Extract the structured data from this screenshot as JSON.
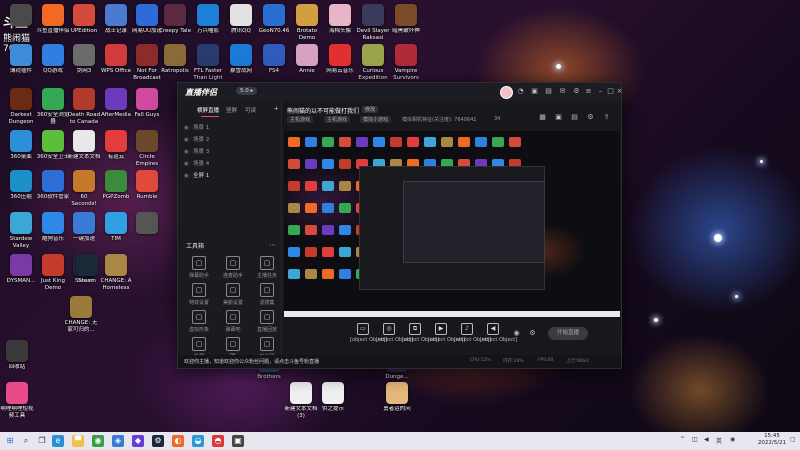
{
  "overlay": {
    "logo": "斗鱼",
    "name": "熊闹猫",
    "room": "7640"
  },
  "desktop": {
    "col1": [
      {
        "label": "",
        "color": "#4a4a4a",
        "icon": "computer-icon"
      },
      {
        "label": "薄荷插件",
        "color": "#3d8bd9",
        "icon": "app-icon"
      },
      {
        "label": "Darkest Dungeon",
        "color": "#6b2a14",
        "icon": "game-icon"
      },
      {
        "label": "360桌面",
        "color": "#2a8ed8",
        "icon": "app-icon"
      },
      {
        "label": "360压缩",
        "color": "#1e90c9",
        "icon": "app-icon"
      },
      {
        "label": "Stardew Valley",
        "color": "#3ca7d6",
        "icon": "game-icon"
      },
      {
        "label": "DYSMAN...",
        "color": "#7a3aa6",
        "icon": "game-icon"
      }
    ],
    "col2": [
      {
        "label": "斗鱼直播伴侣",
        "color": "#f16a25",
        "icon": "app-icon"
      },
      {
        "label": "QQ游戏",
        "color": "#2f7ee0",
        "icon": "app-icon"
      },
      {
        "label": "360安全浏览器",
        "color": "#34a853",
        "icon": "app-icon"
      },
      {
        "label": "360安全卫士",
        "color": "#5bbf3c",
        "icon": "app-icon"
      },
      {
        "label": "360软件管家",
        "color": "#2b6fd6",
        "icon": "app-icon"
      },
      {
        "label": "酷狗音乐",
        "color": "#2d89e5",
        "icon": "app-icon"
      },
      {
        "label": "Just King Demo",
        "color": "#c33c2c",
        "icon": "game-icon"
      }
    ],
    "col3": [
      {
        "label": "UPEdition",
        "color": "#d44b3c",
        "icon": "app-icon"
      },
      {
        "label": "剑网3",
        "color": "#6b6b6b",
        "icon": "game-icon"
      },
      {
        "label": "Death Road to Canada",
        "color": "#b13a2a",
        "icon": "game-icon"
      },
      {
        "label": "新建文本文档",
        "color": "#e8e8e8",
        "icon": "document-icon"
      },
      {
        "label": "60 Seconds! Reatomized",
        "color": "#c47a2a",
        "icon": "game-icon"
      },
      {
        "label": "一键加速",
        "color": "#3a7bd5",
        "icon": "app-icon"
      },
      {
        "label": "Steam",
        "color": "#1b2838",
        "icon": "steam-icon"
      }
    ],
    "col4": [
      {
        "label": "战士记录",
        "color": "#4b7bd1",
        "icon": "app-icon"
      },
      {
        "label": "WPS Office",
        "color": "#d23b3b",
        "icon": "app-icon"
      },
      {
        "label": "AfterMedia",
        "color": "#6c3bbd",
        "icon": "app-icon"
      },
      {
        "label": "有道云",
        "color": "#e23c3c",
        "icon": "app-icon"
      },
      {
        "label": "PGPZomb",
        "color": "#3c8a3c",
        "icon": "game-icon"
      },
      {
        "label": "TIM",
        "color": "#2fa0e6",
        "icon": "app-icon"
      },
      {
        "label": "CHANGE: A Homeless",
        "color": "#aa8844",
        "icon": "game-icon"
      }
    ],
    "col5": [
      {
        "label": "网易UU加速",
        "color": "#2f6bd8",
        "icon": "app-icon"
      },
      {
        "label": "Not For Broadcast",
        "color": "#8b2b2b",
        "icon": "game-icon"
      },
      {
        "label": "Fall Guys",
        "color": "#d04aa0",
        "icon": "game-icon"
      },
      {
        "label": "Circle Empires",
        "color": "#6a4a2a",
        "icon": "game-icon"
      },
      {
        "label": "Rumble",
        "color": "#e04a3a",
        "icon": "game-icon"
      },
      {
        "label": "",
        "color": "#555555",
        "icon": "app-icon"
      }
    ],
    "row1_extra": [
      {
        "label": "Creepy Tale",
        "color": "#5a2a40",
        "icon": "game-icon"
      },
      {
        "label": "万兴喵影",
        "color": "#1e7fd6",
        "icon": "app-icon"
      },
      {
        "label": "腾讯QQ",
        "color": "#e2e2e2",
        "icon": "qq-icon"
      },
      {
        "label": "GeoN70.46",
        "color": "#2a6fd0",
        "icon": "app-icon"
      },
      {
        "label": "Brotato Demo",
        "color": "#d0a040",
        "icon": "game-icon"
      },
      {
        "label": "海棉头像",
        "color": "#e7b4c8",
        "icon": "app-icon"
      },
      {
        "label": "Devil Slayer Raksasi",
        "color": "#3a3a5a",
        "icon": "game-icon"
      },
      {
        "label": "暗黑破坏神",
        "color": "#7a4a2a",
        "icon": "game-icon"
      }
    ],
    "row2_extra": [
      {
        "label": "Ratropolis",
        "color": "#8b6a3a",
        "icon": "game-icon"
      },
      {
        "label": "FTL Faster Than Light",
        "color": "#2a3a6a",
        "icon": "game-icon"
      },
      {
        "label": "暴雪战网",
        "color": "#1a7ad6",
        "icon": "app-icon"
      },
      {
        "label": "FS4",
        "color": "#2f5bbd",
        "icon": "app-icon"
      },
      {
        "label": "Annie",
        "color": "#d6a2c0",
        "icon": "game-icon"
      },
      {
        "label": "网易云音乐",
        "color": "#e23030",
        "icon": "app-icon"
      },
      {
        "label": "Curious Expedition",
        "color": "#9aa44a",
        "icon": "game-icon"
      },
      {
        "label": "Vampire Survivors",
        "color": "#b02a3a",
        "icon": "game-icon"
      }
    ],
    "lower_left": [
      {
        "label": "CHANGE: 无家可归的...",
        "color": "#9a7a3a",
        "icon": "game-icon"
      },
      {
        "label": "Steam",
        "color": "#1b2838",
        "icon": "steam-icon"
      },
      {
        "label": "回收站",
        "color": "#3a3a3a",
        "icon": "recycle-bin-icon"
      },
      {
        "label": "啊哩啊哩短视频工具",
        "color": "#e84a8a",
        "icon": "app-icon"
      }
    ],
    "bottom_row": [
      {
        "label": "Brothers",
        "color": "#2a5a7a",
        "icon": "game-icon"
      },
      {
        "label": "新建文本文档(3)",
        "color": "#f0f0f0",
        "icon": "document-icon"
      },
      {
        "label": "供之提示",
        "color": "#f0f0f0",
        "icon": "document-icon"
      },
      {
        "label": "Dunge...",
        "color": "#3a2a5a",
        "icon": "game-icon"
      },
      {
        "label": "勇者运的问",
        "color": "#e4b87a",
        "icon": "game-icon"
      }
    ]
  },
  "app": {
    "logo": "直播伴侣",
    "version": "5.0 ▸",
    "tabs": [
      "横屏直播",
      "竖屏",
      "可读"
    ],
    "scenes": [
      "场景 1",
      "场景 2",
      "场景 3",
      "场景 4",
      "全屏 1"
    ],
    "tools_title": "工具箱",
    "tools": [
      {
        "label": "弹幕助手"
      },
      {
        "label": "连麦助手"
      },
      {
        "label": "主播任务"
      },
      {
        "label": "特效设置"
      },
      {
        "label": "美颜设置"
      },
      {
        "label": "滤镜集"
      },
      {
        "label": "虚拟形象"
      },
      {
        "label": "弹幕吧"
      },
      {
        "label": "直播回放"
      },
      {
        "label": "投屏"
      },
      {
        "label": "PK"
      },
      {
        "label": "粉丝团"
      }
    ],
    "room_title": "熊闹猫的以不可能做打我们",
    "edit": "修改",
    "chips": [
      "主机游戏",
      "主机游戏",
      "模拟小游戏"
    ],
    "meta_id": "模拟相机特征(关注度): 7640641",
    "meta_fans": "34",
    "controls": [
      {
        "label": "直播屏幕"
      },
      {
        "label": "摄像头"
      },
      {
        "label": "多机位屏"
      },
      {
        "label": "多媒体"
      },
      {
        "label": "麦克风"
      },
      {
        "label": "扬声器"
      }
    ],
    "start": "开始直播",
    "notice": "欢迎你主播，知道欢迎你公众粉丝问题，请点击斗鱼号粉直播",
    "stats": [
      "CPU:12%",
      "内存:18%",
      "FPS:60",
      "上行:0Kb/s"
    ]
  },
  "taskbar": {
    "clock_time": "15:45",
    "clock_date": "2022/5/21",
    "lang": "英",
    "tray": "^"
  }
}
